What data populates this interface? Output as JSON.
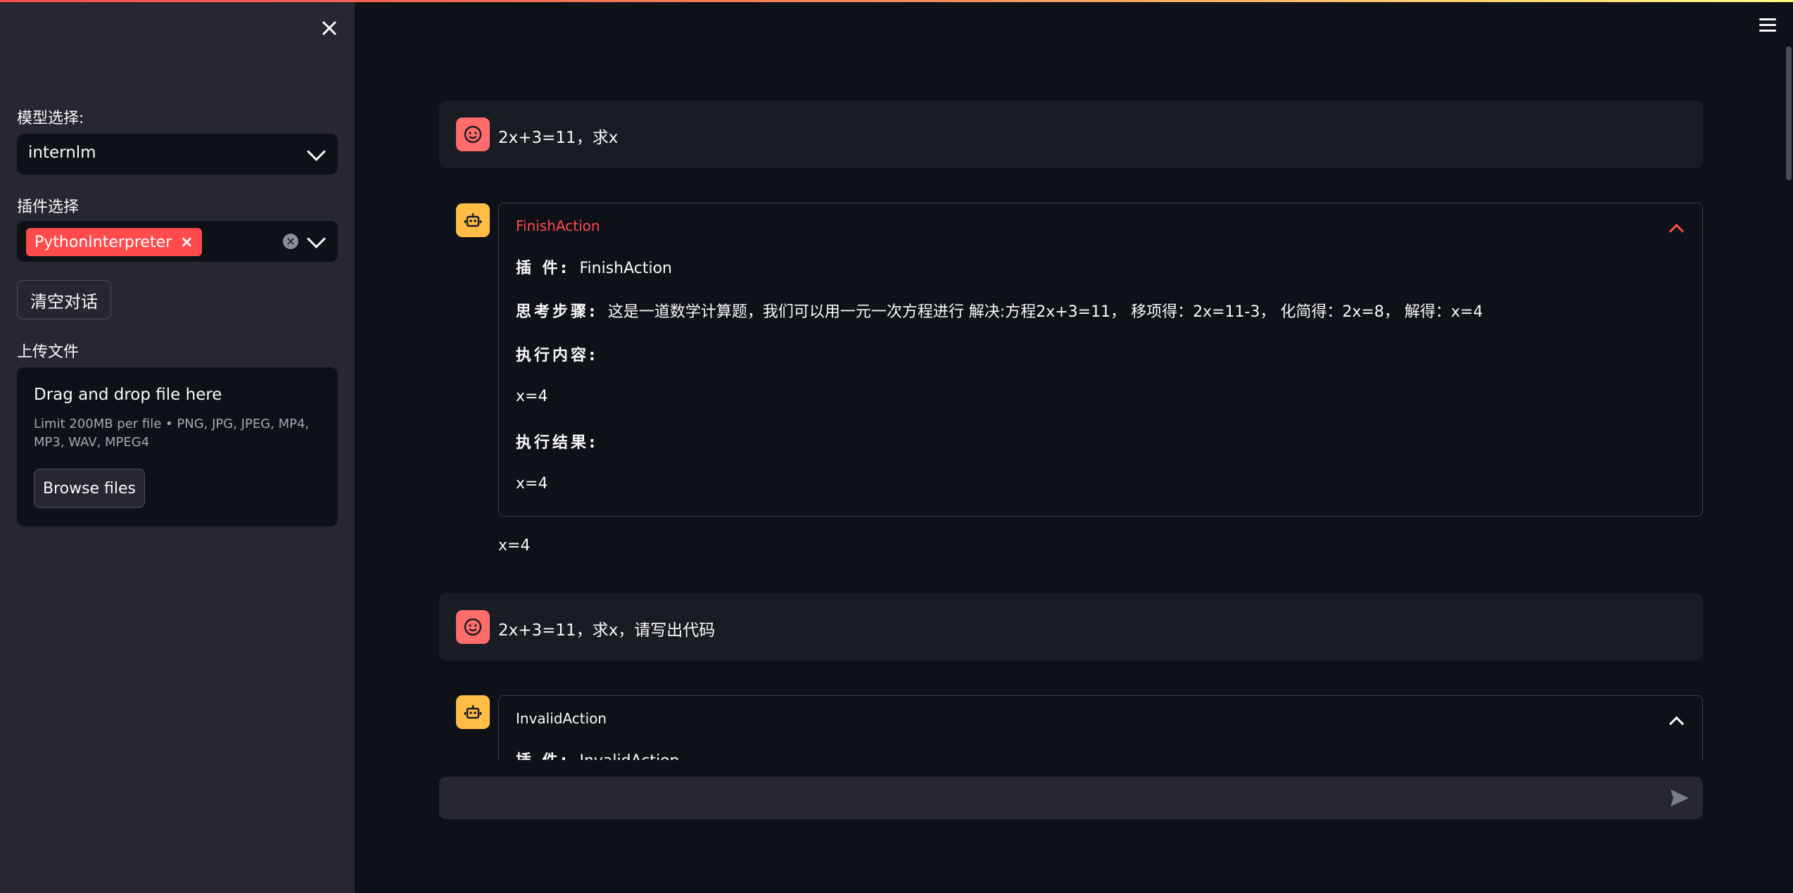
{
  "colors": {
    "accent": "#ff4b4b",
    "user_avatar": "#ff6c6c",
    "bot_avatar": "#ffbd45",
    "sidebar_bg": "#262730",
    "main_bg": "#0e1117"
  },
  "sidebar": {
    "close_icon": "close-icon",
    "model_label": "模型选择:",
    "model_value": "internlm",
    "plugin_label": "插件选择",
    "plugin_tag": "PythonInterpreter",
    "plugin_tag_remove": "×",
    "clear_chat_button": "清空对话",
    "upload_label": "上传文件",
    "upload_title": "Drag and drop file here",
    "upload_hint": "Limit 200MB per file • PNG, JPG, JPEG, MP4, MP3, WAV, MPEG4",
    "browse_button": "Browse files"
  },
  "chat": {
    "messages": [
      {
        "role": "user",
        "text": "2x+3=11，求x"
      },
      {
        "role": "assistant",
        "expander_title": "FinishAction",
        "plugin_label": "插 件:",
        "plugin_value": "FinishAction",
        "thought_label": "思考步骤:",
        "thought_value": "这是一道数学计算题，我们可以用一元一次方程进行 解决:方程2x+3=11， 移项得：2x=11-3， 化简得：2x=8， 解得：x=4",
        "exec_content_label": "执行内容:",
        "exec_content_value": "x=4",
        "exec_result_label": "执行结果:",
        "exec_result_value": "x=4",
        "answer": "x=4"
      },
      {
        "role": "user",
        "text": "2x+3=11，求x，请写出代码"
      },
      {
        "role": "assistant",
        "expander_title": "InvalidAction",
        "plugin_label": "插 件:",
        "plugin_value": "InvalidAction"
      }
    ],
    "input_placeholder": ""
  }
}
